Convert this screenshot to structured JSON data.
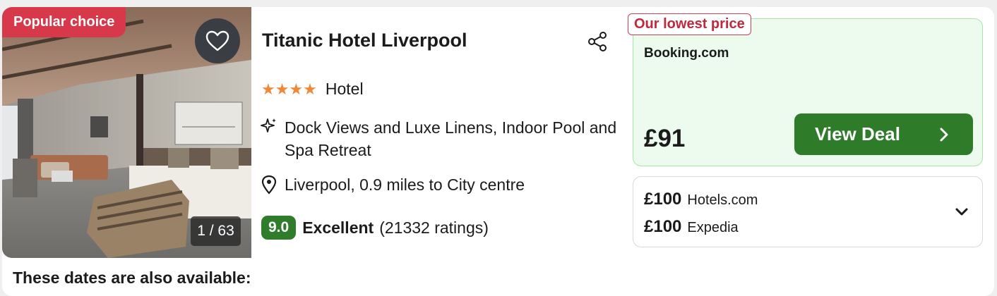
{
  "badge": {
    "popular": "Popular choice"
  },
  "photo": {
    "counter": "1 / 63"
  },
  "hotel": {
    "name": "Titanic Hotel Liverpool",
    "stars": "★★★★",
    "star_count": 4,
    "type": "Hotel",
    "feature": "Dock Views and Luxe Linens, Indoor Pool and Spa Retreat",
    "location": "Liverpool, 0.9 miles to City centre",
    "score": "9.0",
    "rating_label": "Excellent",
    "rating_count": "(21332 ratings)"
  },
  "deal": {
    "badge": "Our lowest price",
    "provider": "Booking.com",
    "price": "£91",
    "button": "View Deal"
  },
  "other_prices": [
    {
      "price": "£100",
      "provider": "Hotels.com"
    },
    {
      "price": "£100",
      "provider": "Expedia"
    }
  ],
  "footer": {
    "dates_heading": "These dates are also available:"
  },
  "colors": {
    "popular_badge": "#d8394a",
    "stars": "#f0883a",
    "score_badge": "#2f7d2a",
    "deal_bg": "#ecfbed",
    "deal_border": "#a8e4a6",
    "lowest_price_text": "#c0293c",
    "view_deal_button": "#2e7b2a"
  },
  "icons": [
    "heart-icon",
    "share-icon",
    "sparkle-icon",
    "location-pin-icon",
    "chevron-right-icon",
    "chevron-down-icon"
  ]
}
